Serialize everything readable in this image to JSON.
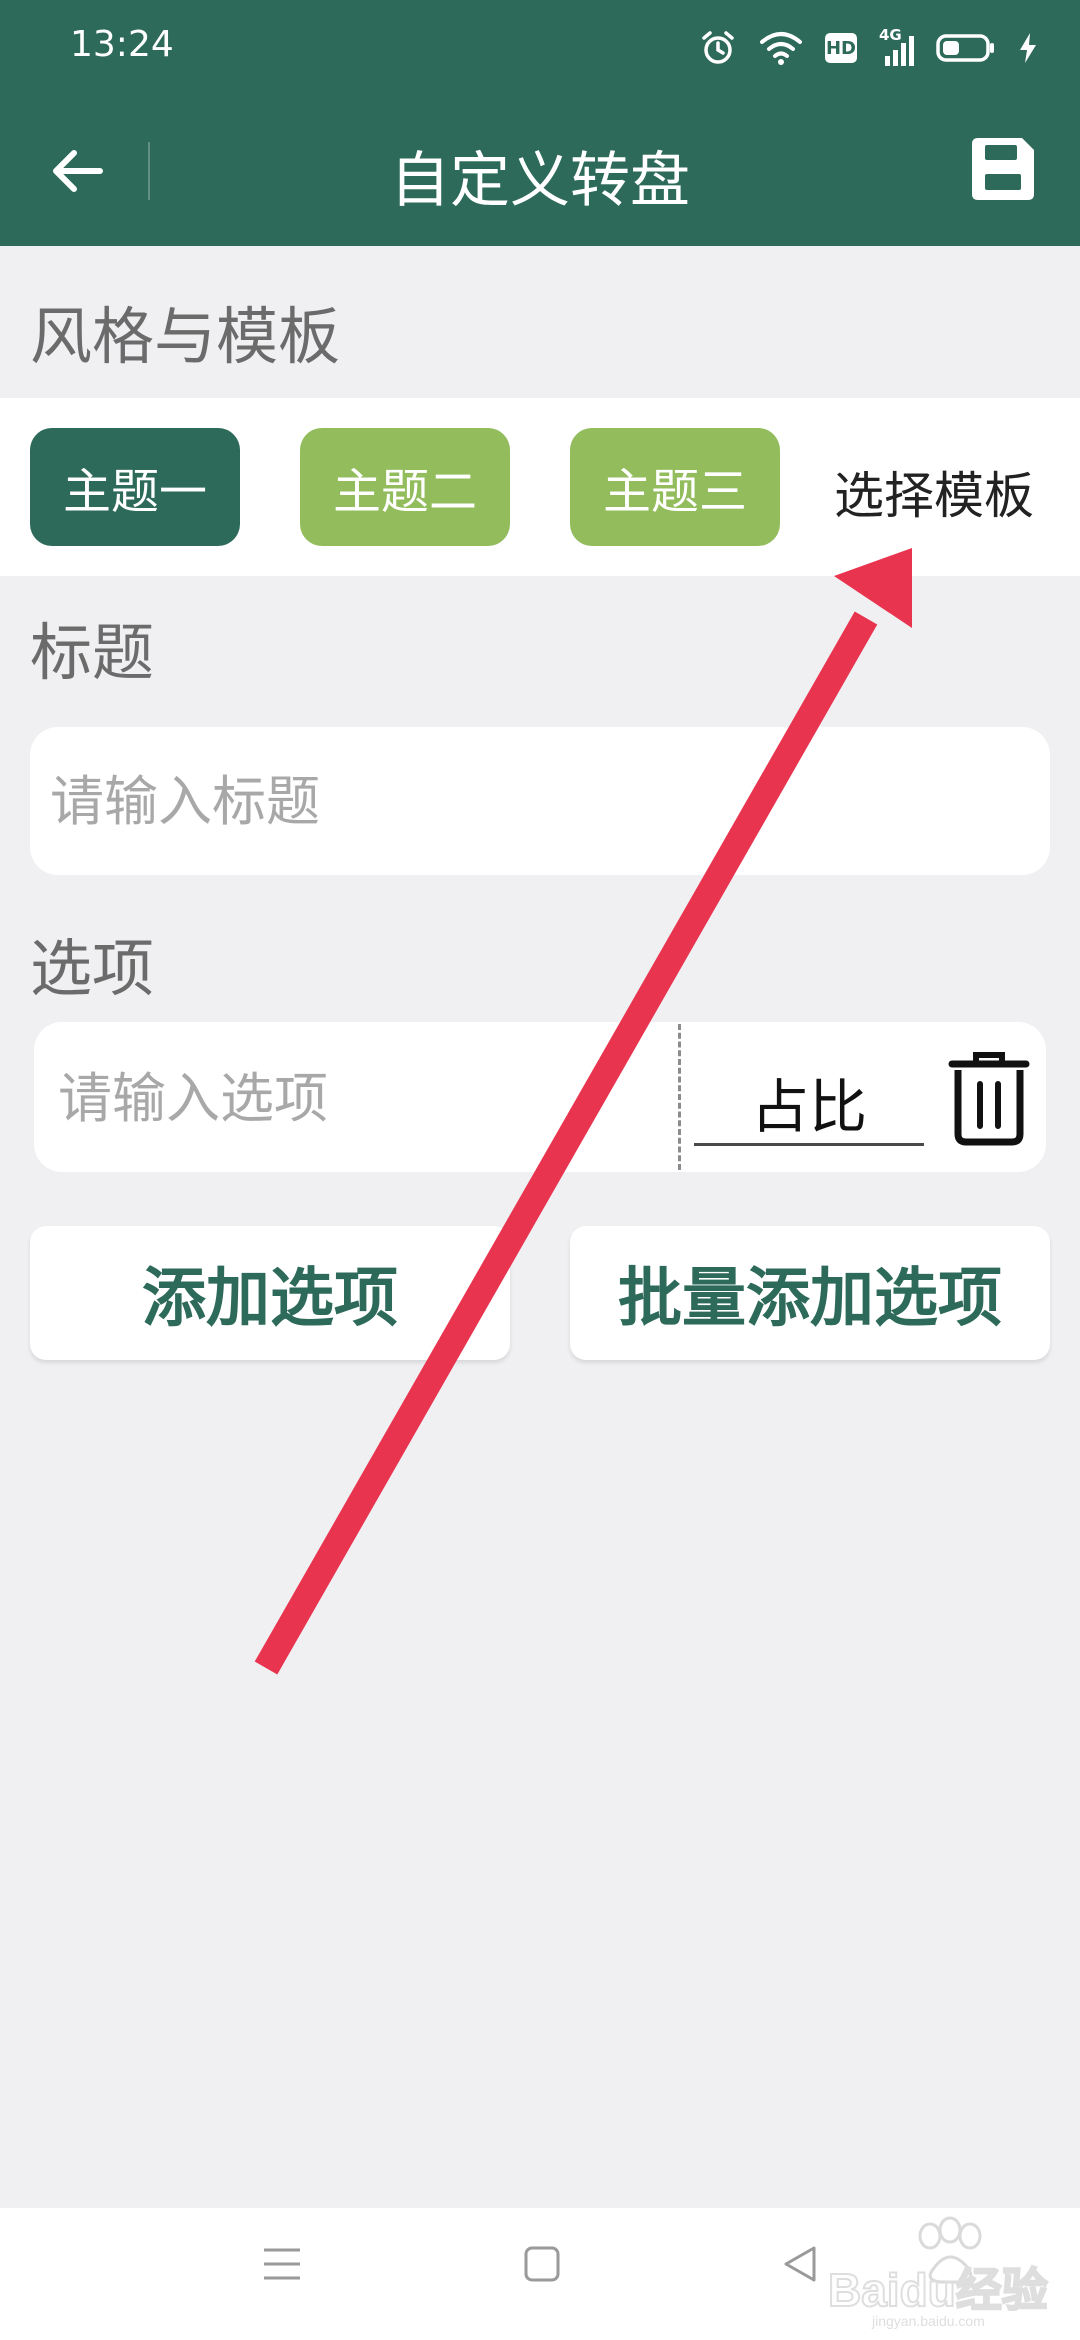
{
  "status_bar": {
    "time": "13:24",
    "icons": [
      "alarm-icon",
      "wifi-icon",
      "hd-icon",
      "signal-4g-icon",
      "battery-icon",
      "charging-icon"
    ],
    "hd_label": "HD",
    "network_label": "4G"
  },
  "header": {
    "title": "自定义转盘",
    "background_color": "#2d6a5a"
  },
  "style_section": {
    "label": "风格与模板",
    "themes": [
      {
        "label": "主题一",
        "color": "#2d6a5a",
        "selected": true
      },
      {
        "label": "主题二",
        "color": "#93bd5c",
        "selected": false
      },
      {
        "label": "主题三",
        "color": "#93bd5c",
        "selected": false
      }
    ],
    "template_link": "选择模板"
  },
  "title_section": {
    "label": "标题",
    "input_placeholder": "请输入标题",
    "input_value": ""
  },
  "options_section": {
    "label": "选项",
    "option_placeholder": "请输入选项",
    "option_value": "",
    "ratio_label": "占比"
  },
  "actions": {
    "add_option": "添加选项",
    "batch_add_option": "批量添加选项"
  },
  "watermark": {
    "text": "Baidu经验",
    "subtext": "jingyan.baidu.com"
  },
  "annotation": {
    "arrow_color": "#e8344e"
  }
}
